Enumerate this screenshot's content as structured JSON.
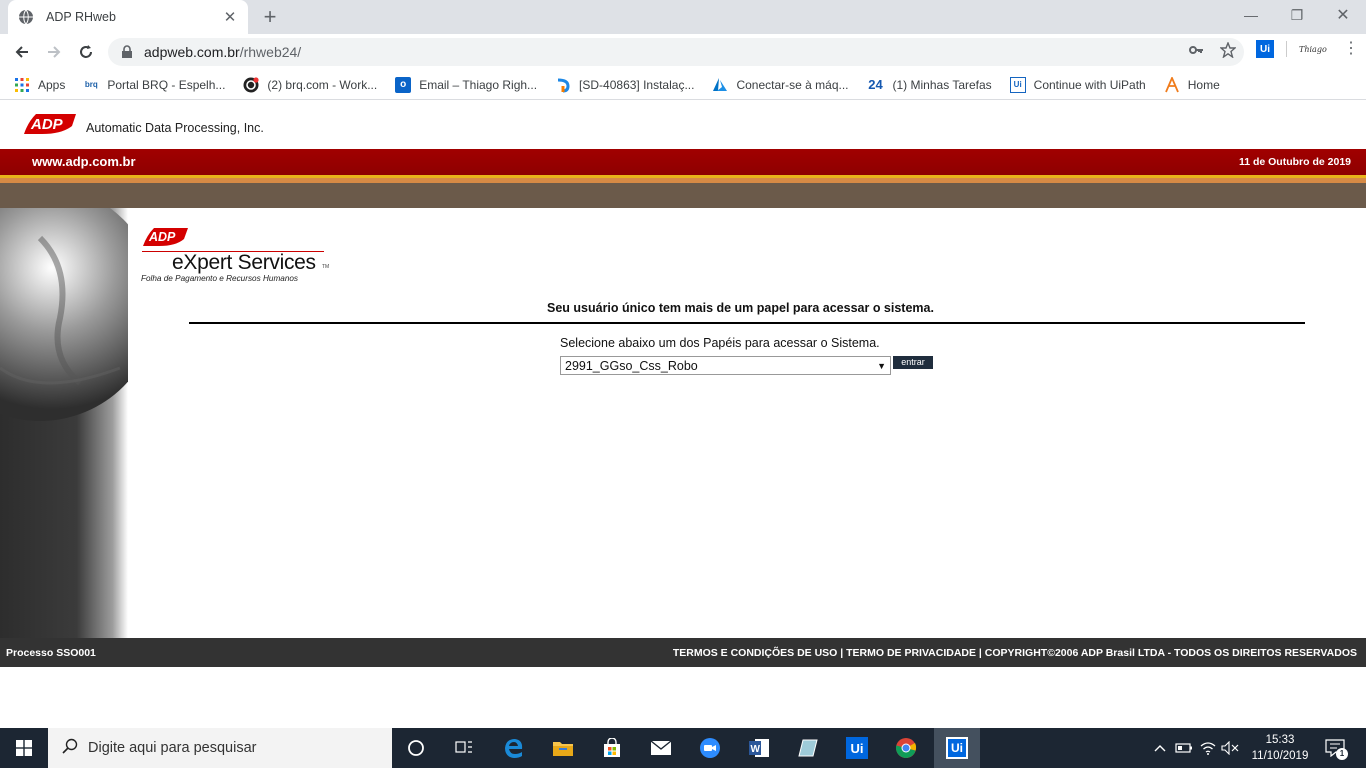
{
  "browser": {
    "tab_title": "ADP RHweb",
    "url_domain": "adpweb.com.br",
    "url_path": "/rhweb24/",
    "profile_label": "Thiago"
  },
  "bookmarks": [
    {
      "label": "Apps",
      "icon": "apps-grid-icon"
    },
    {
      "label": "Portal BRQ - Espelh...",
      "icon": "brq-icon"
    },
    {
      "label": "(2) brq.com - Work...",
      "icon": "workplace-icon"
    },
    {
      "label": "Email – Thiago Righ...",
      "icon": "outlook-icon"
    },
    {
      "label": "[SD-40863] Instalaç...",
      "icon": "jira-icon"
    },
    {
      "label": "Conectar-se à máq...",
      "icon": "azure-icon"
    },
    {
      "label": "(1) Minhas Tarefas",
      "icon": "calendar-24-icon"
    },
    {
      "label": "Continue with UiPath",
      "icon": "uipath-icon"
    },
    {
      "label": "Home",
      "icon": "home-a-icon"
    }
  ],
  "page": {
    "company": "Automatic Data Processing, Inc.",
    "site": "www.adp.com.br",
    "date": "11 de Outubro de 2019",
    "expert_title": "eXpert Services",
    "expert_tm": "TM",
    "expert_sub": "Folha de Pagamento e Recursos Humanos",
    "message": "Seu usuário único tem mais de um papel para acessar o sistema.",
    "prompt": "Selecione abaixo um dos Papéis para acessar o Sistema.",
    "selected_role": "2991_GGso_Css_Robo",
    "enter_label": "entrar",
    "footer_left": "Processo SSO001",
    "footer_right": "TERMOS E CONDIÇÕES DE USO | TERMO DE PRIVACIDADE | COPYRIGHT©2006 ADP Brasil LTDA - TODOS OS DIREITOS RESERVADOS"
  },
  "taskbar": {
    "search_placeholder": "Digite aqui para pesquisar",
    "time": "15:33",
    "date": "11/10/2019",
    "notification_count": "1"
  },
  "colors": {
    "adp_red": "#a10000",
    "brown_bar": "#6b5a4a",
    "footer": "#333333",
    "taskbar": "#1c2633"
  }
}
